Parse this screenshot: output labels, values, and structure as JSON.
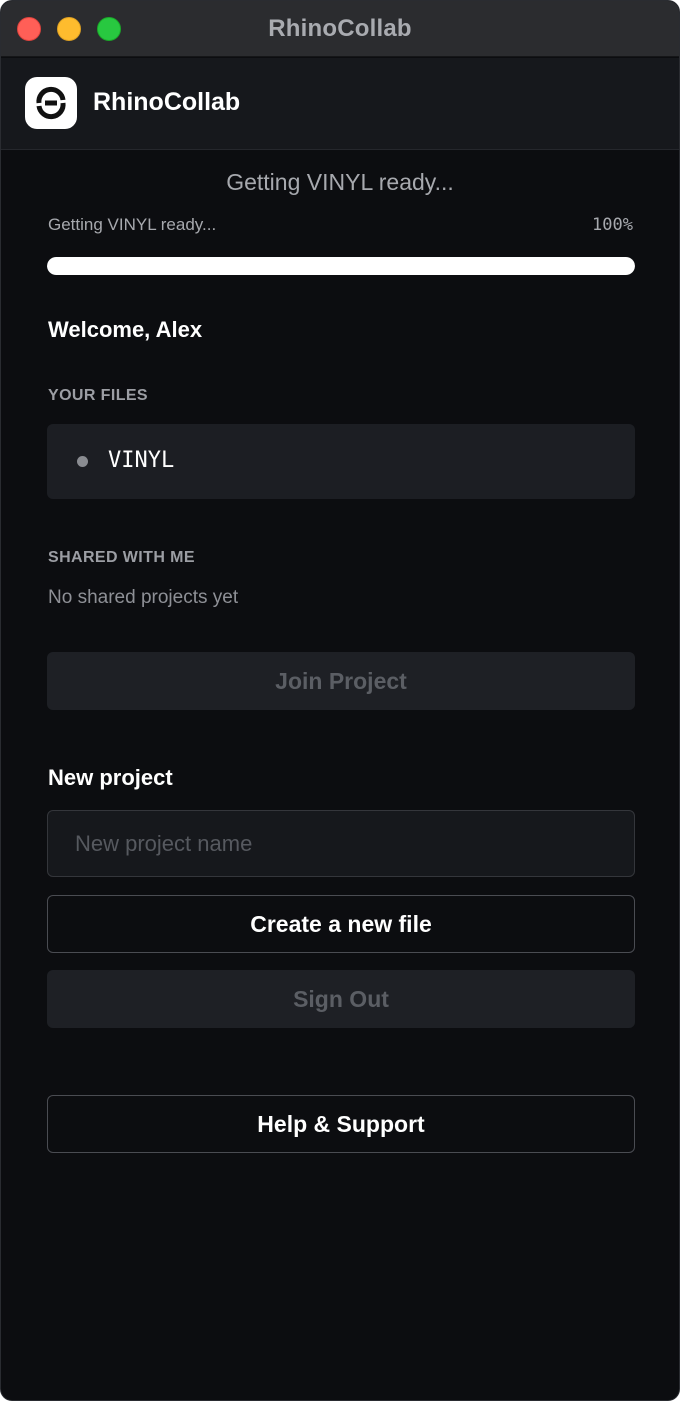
{
  "window": {
    "title": "RhinoCollab"
  },
  "header": {
    "brand": "RhinoCollab",
    "logo_icon": "rhinocollab-logo-icon"
  },
  "status": {
    "title": "Getting VINYL ready...",
    "progress_label": "Getting VINYL ready...",
    "progress_percent_text": "100%",
    "progress_value": 1.0
  },
  "welcome": "Welcome, Alex",
  "your_files": {
    "label": "YOUR FILES",
    "items": [
      {
        "name": "VINYL"
      }
    ]
  },
  "shared": {
    "label": "SHARED WITH ME",
    "empty_text": "No shared projects yet"
  },
  "buttons": {
    "join_project": "Join Project",
    "create_new_file": "Create a new file",
    "sign_out": "Sign Out",
    "help_support": "Help & Support"
  },
  "new_project": {
    "title": "New project",
    "placeholder": "New project name",
    "value": ""
  },
  "colors": {
    "background": "#0c0d10",
    "progress_fill": "#ffffff",
    "muted_button": "#1e2025"
  }
}
